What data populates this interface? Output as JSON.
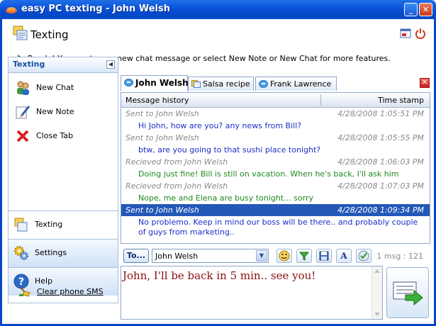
{
  "window": {
    "title": "easy PC texting - John Welsh"
  },
  "header": {
    "title": "Texting"
  },
  "status": {
    "text": "Ready! You can type a new chat message or select New Note or New Chat for more features."
  },
  "sidebar": {
    "heading": "Texting",
    "actions": [
      {
        "label": "New Chat",
        "icon": "people-icon"
      },
      {
        "label": "New Note",
        "icon": "pencil-icon"
      },
      {
        "label": "Close Tab",
        "icon": "red-x-icon"
      }
    ],
    "nav": [
      {
        "label": "Texting",
        "icon": "texting-icon",
        "active": true
      },
      {
        "label": "Settings",
        "icon": "gears-icon"
      },
      {
        "label": "Help",
        "icon": "help-icon"
      }
    ],
    "clear_sms": "Clear phone SMS"
  },
  "tabs": [
    {
      "label": "John Welsh",
      "active": true
    },
    {
      "label": "Salsa recipe"
    },
    {
      "label": "Frank Lawrence"
    }
  ],
  "history": {
    "col_message": "Message history",
    "col_time": "Time stamp",
    "entries": [
      {
        "header": "Sent to John Welsh",
        "time": "4/28/2008 1:05:51 PM",
        "text": "Hi John, how are you? any news from Bill?",
        "kind": "sent"
      },
      {
        "header": "Sent to John Welsh",
        "time": "4/28/2008 1:05:55 PM",
        "text": "btw, are you going to that sushi place tonight?",
        "kind": "sent"
      },
      {
        "header": "Recieved from John Welsh",
        "time": "4/28/2008 1:06:03 PM",
        "text": "Doing just fine! Bill is still on vacation. When he's back, I'll ask him",
        "kind": "recv"
      },
      {
        "header": "Recieved from John Welsh",
        "time": "4/28/2008 1:07:03 PM",
        "text": "Nope, me and Elena are busy tonight... sorry",
        "kind": "recv"
      },
      {
        "header": "Sent to John Welsh",
        "time": "4/28/2008 1:09:34 PM",
        "text": "No problemo. Keep in mind our boss will be there.. and probably couple of guys from marketing..",
        "kind": "sent",
        "selected": true
      }
    ]
  },
  "compose": {
    "to_label": "To...",
    "recipient": "John Welsh",
    "count": "1 msg : 121",
    "text": "John, I'll be back in 5 min.. see you!"
  },
  "colors": {
    "sent": "#1a2fc8",
    "received": "#1e8a1e",
    "selection": "#2458b8",
    "title_bar": "#0a52d8"
  }
}
